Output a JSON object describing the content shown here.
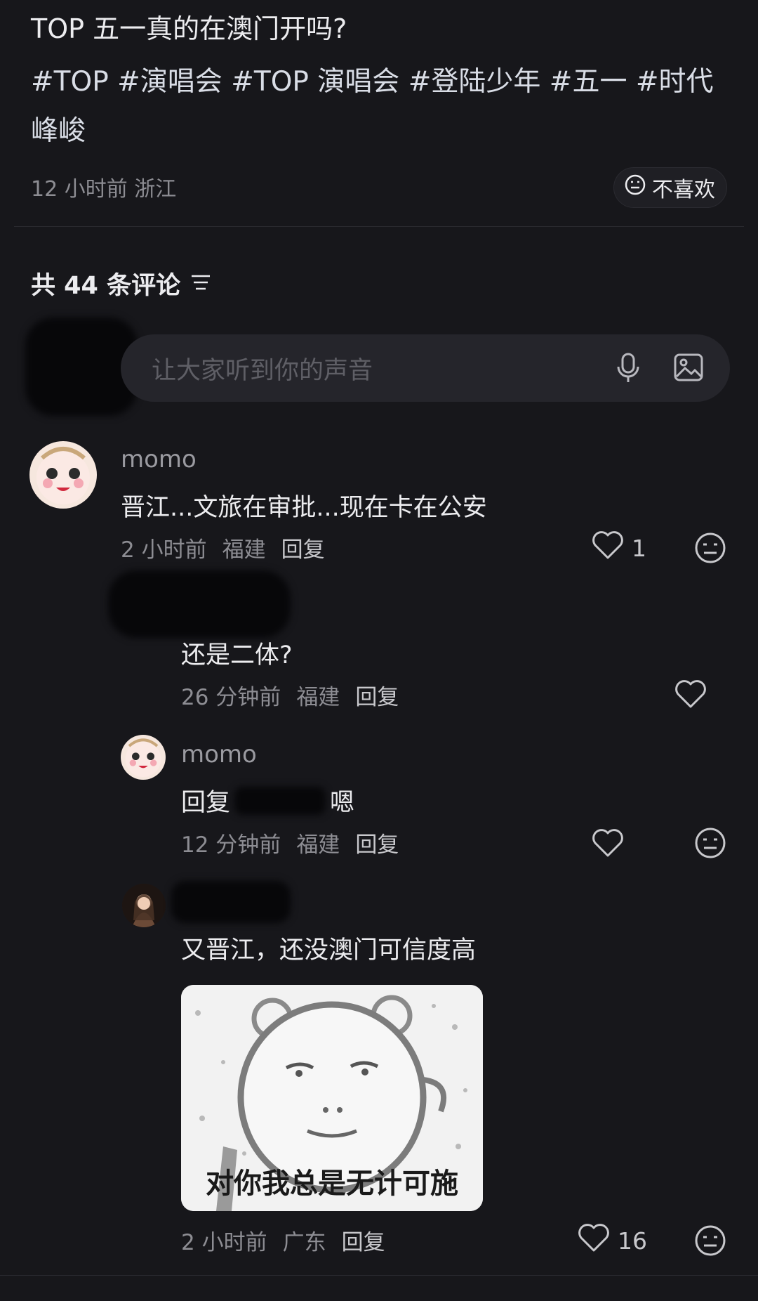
{
  "post": {
    "title": "TOP 五一真的在澳门开吗?",
    "tags": "#TOP #演唱会 #TOP 演唱会 #登陆少年 #五一 #时代峰峻",
    "meta": "12 小时前 浙江",
    "dislike_label": "不喜欢"
  },
  "comments_header": {
    "count_text": "共 44 条评论"
  },
  "composer": {
    "placeholder": "让大家听到你的声音"
  },
  "comments": [
    {
      "username": "momo",
      "text": "晋江...文旅在审批...现在卡在公安",
      "time": "2 小时前",
      "location": "福建",
      "reply_label": "回复",
      "likes": "1"
    },
    {
      "username": "",
      "text": "还是二体?",
      "time": "26 分钟前",
      "location": "福建",
      "reply_label": "回复",
      "likes": ""
    },
    {
      "username": "momo",
      "text_prefix": "回复",
      "text_suffix": "嗯",
      "time": "12 分钟前",
      "location": "福建",
      "reply_label": "回复",
      "likes": ""
    },
    {
      "username": "",
      "text": "又晋江，还没澳门可信度高",
      "sticker_caption": "对你我总是无计可施",
      "time": "2 小时前",
      "location": "广东",
      "reply_label": "回复",
      "likes": "16"
    }
  ],
  "colors": {
    "background": "#17171b",
    "text": "#ececef",
    "muted": "#8d8d93",
    "input_bg": "#25252b"
  }
}
